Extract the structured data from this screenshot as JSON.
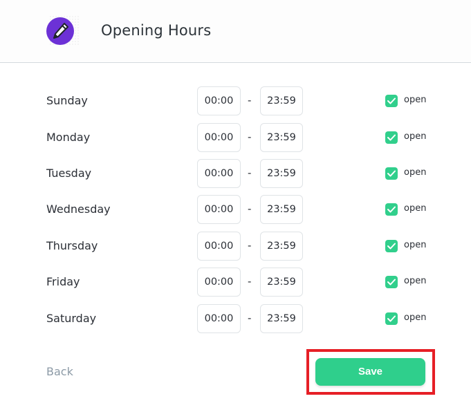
{
  "header": {
    "icon": "pencil-icon",
    "title": "Opening Hours"
  },
  "days": [
    {
      "name": "Sunday",
      "start": "00:00",
      "end": "23:59",
      "separator": "-",
      "open": true,
      "open_label": "open"
    },
    {
      "name": "Monday",
      "start": "00:00",
      "end": "23:59",
      "separator": "-",
      "open": true,
      "open_label": "open"
    },
    {
      "name": "Tuesday",
      "start": "00:00",
      "end": "23:59",
      "separator": "-",
      "open": true,
      "open_label": "open"
    },
    {
      "name": "Wednesday",
      "start": "00:00",
      "end": "23:59",
      "separator": "-",
      "open": true,
      "open_label": "open"
    },
    {
      "name": "Thursday",
      "start": "00:00",
      "end": "23:59",
      "separator": "-",
      "open": true,
      "open_label": "open"
    },
    {
      "name": "Friday",
      "start": "00:00",
      "end": "23:59",
      "separator": "-",
      "open": true,
      "open_label": "open"
    },
    {
      "name": "Saturday",
      "start": "00:00",
      "end": "23:59",
      "separator": "-",
      "open": true,
      "open_label": "open"
    }
  ],
  "footer": {
    "back_label": "Back",
    "save_label": "Save"
  },
  "colors": {
    "accent": "#2fcf8c",
    "logo": "#6c31d6",
    "highlight": "#e61f26"
  }
}
